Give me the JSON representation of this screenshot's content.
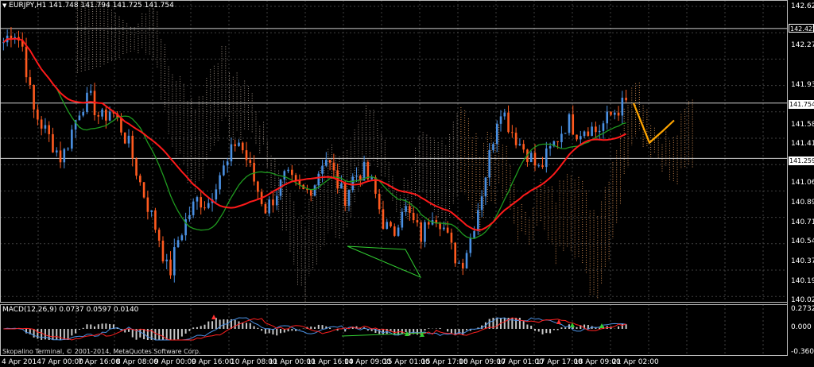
{
  "window": {
    "symbol_caption": "EURJPY,H1",
    "ohlc": "141.748 141.794 141.725 141.754"
  },
  "price_axis": {
    "ticks": [
      "142.620",
      "142.275",
      "141.930",
      "141.580",
      "141.410",
      "141.060",
      "140.890",
      "140.715",
      "140.545",
      "140.370",
      "140.195",
      "140.025"
    ],
    "highlighted": [
      {
        "value": "142.422",
        "kind": "horizontal-line"
      },
      {
        "value": "141.754",
        "kind": "current-bid"
      },
      {
        "value": "141.259",
        "kind": "horizontal-line"
      }
    ]
  },
  "indicator": {
    "caption": "MACD(12,26,9) 0.0737 0.0597 0.0140",
    "ticks": [
      "0.2732",
      "0.000",
      "-0.360"
    ]
  },
  "time_axis": {
    "ticks": [
      "4 Apr 2014",
      "7 Apr 00:00",
      "7 Apr 16:00",
      "8 Apr 08:00",
      "9 Apr 00:00",
      "9 Apr 16:00",
      "10 Apr 08:00",
      "11 Apr 00:00",
      "11 Apr 16:00",
      "14 Apr 09:00",
      "15 Apr 01:00",
      "15 Apr 17:00",
      "16 Apr 09:00",
      "17 Apr 01:00",
      "17 Apr 17:00",
      "18 Apr 09:00",
      "21 Apr 02:00"
    ]
  },
  "watermark": "Skopalino Terminal, © 2001-2014, MetaQuotes Software Corp.",
  "colors": {
    "background": "#000000",
    "grid": "#404040",
    "bull_candle": "#4a90e2",
    "bear_candle": "#ff5a1f",
    "ma_red": "#ff1a1a",
    "ma_green": "#1f9a1f",
    "cloud_dots": "#b8a89a",
    "cloud_orange": "#f4a460",
    "forecast": "#ffa500",
    "trendline": "#32cd32",
    "macd_hist": "#c8c8c8",
    "macd_signal": "#ff2020",
    "macd_line": "#4a90e2"
  },
  "chart_data": {
    "type": "candlestick",
    "title": "EURJPY,H1",
    "ylim": [
      140.025,
      142.62
    ],
    "notes": "Hourly EURJPY candles with moving averages, Ichimoku-style cloud and MACD(12,26,9) subwindow",
    "close_path": [
      142.3,
      142.42,
      142.25,
      141.7,
      141.55,
      141.4,
      141.25,
      141.5,
      141.75,
      141.78,
      141.6,
      141.7,
      141.55,
      141.35,
      141.05,
      140.8,
      140.55,
      140.2,
      140.55,
      140.75,
      140.9,
      140.85,
      141.1,
      141.2,
      141.45,
      141.25,
      141.0,
      140.8,
      140.95,
      141.1,
      141.0,
      140.95,
      141.05,
      141.3,
      141.1,
      140.9,
      141.1,
      141.15,
      141.0,
      140.7,
      140.55,
      140.85,
      140.7,
      140.55,
      140.8,
      140.7,
      140.45,
      140.3,
      140.55,
      140.9,
      141.3,
      141.75,
      141.55,
      141.4,
      141.3,
      141.15,
      141.3,
      141.45,
      141.6,
      141.5,
      141.55,
      141.5,
      141.6,
      141.7,
      141.75
    ],
    "forecast_path": [
      141.754,
      141.4,
      141.5,
      141.6
    ]
  }
}
